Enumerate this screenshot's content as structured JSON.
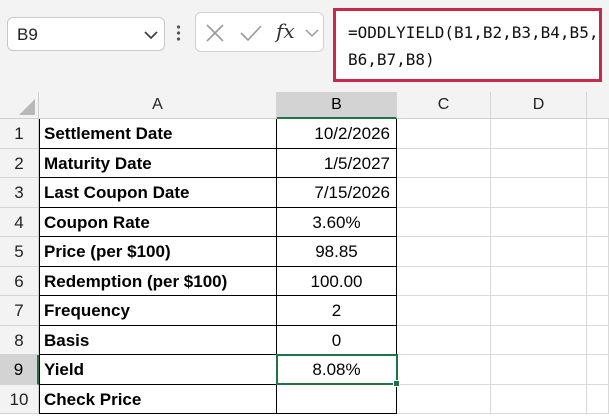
{
  "name_box": {
    "value": "B9"
  },
  "formula_bar": {
    "cancel_icon": "x-icon",
    "enter_icon": "check-icon",
    "function_icon": "fx-icon",
    "function_label": "fx",
    "formula": "=ODDLYIELD(B1,B2,B3,B4,B5,B6,B7,B8)"
  },
  "columns": [
    "A",
    "B",
    "C",
    "D"
  ],
  "selected_column": "B",
  "selected_row": 9,
  "active_cell": "B9",
  "rows": [
    {
      "num": "1",
      "label": "Settlement Date",
      "value": "10/2/2026"
    },
    {
      "num": "2",
      "label": "Maturity Date",
      "value": "1/5/2027"
    },
    {
      "num": "3",
      "label": "Last Coupon Date",
      "value": "7/15/2026"
    },
    {
      "num": "4",
      "label": "Coupon Rate",
      "value": "3.60%"
    },
    {
      "num": "5",
      "label": "Price (per $100)",
      "value": "98.85"
    },
    {
      "num": "6",
      "label": "Redemption (per $100)",
      "value": "100.00"
    },
    {
      "num": "7",
      "label": "Frequency",
      "value": "2"
    },
    {
      "num": "8",
      "label": "Basis",
      "value": "0"
    },
    {
      "num": "9",
      "label": "Yield",
      "value": "8.08%"
    },
    {
      "num": "10",
      "label": "Check Price",
      "value": ""
    }
  ],
  "colors": {
    "accent": "#217346",
    "formula_highlight": "#c8284a"
  }
}
